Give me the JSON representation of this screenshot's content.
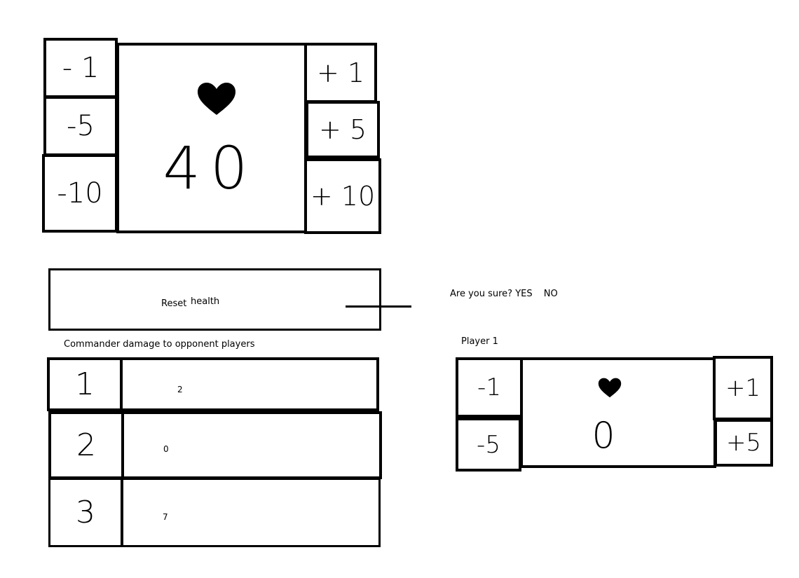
{
  "main_counter": {
    "minus_buttons": [
      "- 1",
      "-5",
      "-10"
    ],
    "plus_buttons": [
      "+ 1",
      "+ 5",
      "+ 10"
    ],
    "life_total": "40",
    "heart_icon": "heart-icon"
  },
  "reset": {
    "label_1": "Reset",
    "label_2": "health",
    "confirm_prompt": "Are you sure?",
    "yes": "YES",
    "no": "NO"
  },
  "commander": {
    "title": "Commander damage to opponent players",
    "rows": [
      {
        "player": "1",
        "damage": "2"
      },
      {
        "player": "2",
        "damage": "0"
      },
      {
        "player": "3",
        "damage": "7"
      }
    ]
  },
  "player_panel": {
    "title": "Player 1",
    "minus_buttons": [
      "-1",
      "-5"
    ],
    "plus_buttons": [
      "+1",
      "+5"
    ],
    "life_total": "0",
    "heart_icon": "heart-icon"
  }
}
